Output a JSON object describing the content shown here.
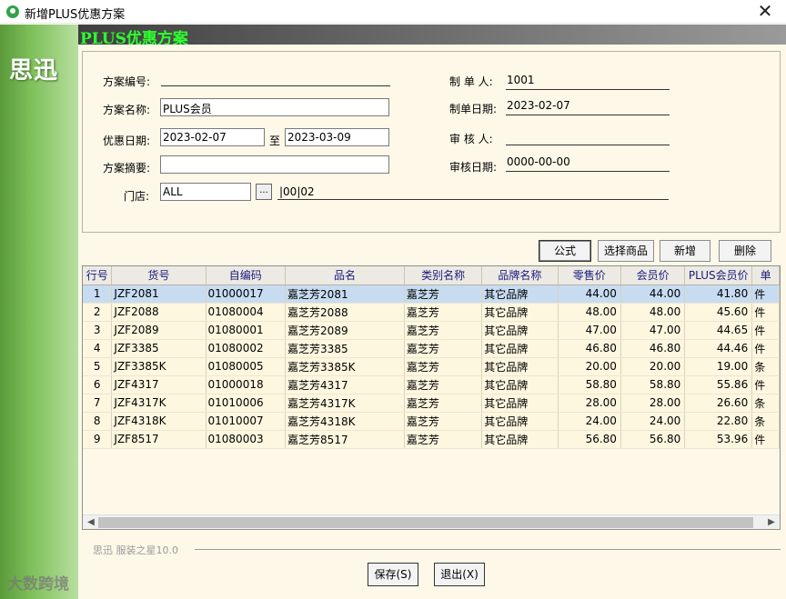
{
  "window": {
    "title": "新增PLUS优惠方案",
    "close_glyph": "✕"
  },
  "sidebar": {
    "logo": "思迅"
  },
  "header": {
    "title": "PLUS优惠方案"
  },
  "form": {
    "plan_no_label": "方案编号:",
    "plan_no_value": "",
    "plan_name_label": "方案名称:",
    "plan_name_value": "PLUS会员",
    "date_label": "优惠日期:",
    "date_from": "2023-02-07",
    "date_to_sep": "至",
    "date_to": "2023-03-09",
    "summary_label": "方案摘要:",
    "summary_value": "",
    "store_label": "门店:",
    "store_value": "ALL",
    "store_browse": "...",
    "store_codes": "|00|02",
    "creator_label": "制 单 人:",
    "creator_value": "1001",
    "create_date_label": "制单日期:",
    "create_date_value": "2023-02-07",
    "reviewer_label": "审 核 人:",
    "reviewer_value": "",
    "review_date_label": "审核日期:",
    "review_date_value": "0000-00-00"
  },
  "toolbar": {
    "formula": "公式",
    "select_goods": "选择商品",
    "add": "新增",
    "delete": "删除"
  },
  "table": {
    "headers": [
      "行号",
      "货号",
      "自编码",
      "品名",
      "类别名称",
      "品牌名称",
      "零售价",
      "会员价",
      "PLUS会员价",
      "单"
    ],
    "rows": [
      [
        "1",
        "JZF2081",
        "01000017",
        "嘉芝芳2081",
        "嘉芝芳",
        "其它品牌",
        "44.00",
        "44.00",
        "41.80",
        "件"
      ],
      [
        "2",
        "JZF2088",
        "01080004",
        "嘉芝芳2088",
        "嘉芝芳",
        "其它品牌",
        "48.00",
        "48.00",
        "45.60",
        "件"
      ],
      [
        "3",
        "JZF2089",
        "01080001",
        "嘉芝芳2089",
        "嘉芝芳",
        "其它品牌",
        "47.00",
        "47.00",
        "44.65",
        "件"
      ],
      [
        "4",
        "JZF3385",
        "01080002",
        "嘉芝芳3385",
        "嘉芝芳",
        "其它品牌",
        "46.80",
        "46.80",
        "44.46",
        "件"
      ],
      [
        "5",
        "JZF3385K",
        "01080005",
        "嘉芝芳3385K",
        "嘉芝芳",
        "其它品牌",
        "20.00",
        "20.00",
        "19.00",
        "条"
      ],
      [
        "6",
        "JZF4317",
        "01000018",
        "嘉芝芳4317",
        "嘉芝芳",
        "其它品牌",
        "58.80",
        "58.80",
        "55.86",
        "件"
      ],
      [
        "7",
        "JZF4317K",
        "01010006",
        "嘉芝芳4317K",
        "嘉芝芳",
        "其它品牌",
        "28.00",
        "28.00",
        "26.60",
        "条"
      ],
      [
        "8",
        "JZF4318K",
        "01010007",
        "嘉芝芳4318K",
        "嘉芝芳",
        "其它品牌",
        "24.00",
        "24.00",
        "22.80",
        "条"
      ],
      [
        "9",
        "JZF8517",
        "01080003",
        "嘉芝芳8517",
        "嘉芝芳",
        "其它品牌",
        "56.80",
        "56.80",
        "53.96",
        "件"
      ]
    ],
    "selected_row": 0
  },
  "footer": {
    "brand": "思迅 服装之星10.0",
    "save": "保存(S)",
    "exit": "退出(X)"
  },
  "watermark": "大数跨境",
  "colors": {
    "sidebar_green": "#7ec05a",
    "header_green_text": "#2eff2e",
    "panel_bg": "#fdf8e8",
    "selected_row": "#c7dcf1"
  }
}
